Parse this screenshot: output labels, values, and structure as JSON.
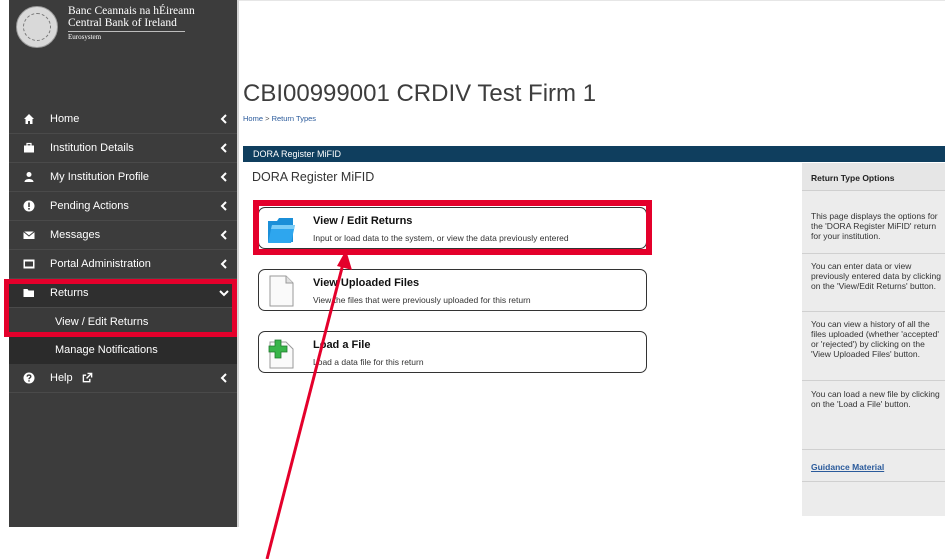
{
  "logo": {
    "line_irish": "Banc Ceannais na hÉireann",
    "line_english": "Central Bank of Ireland",
    "line_eurosystem": "Eurosystem"
  },
  "nav": {
    "items": [
      {
        "label": "Home",
        "icon": "home-icon"
      },
      {
        "label": "Institution Details",
        "icon": "briefcase-icon"
      },
      {
        "label": "My Institution Profile",
        "icon": "user-icon"
      },
      {
        "label": "Pending Actions",
        "icon": "alert-icon"
      },
      {
        "label": "Messages",
        "icon": "envelope-icon"
      },
      {
        "label": "Portal Administration",
        "icon": "panel-icon"
      },
      {
        "label": "Returns",
        "icon": "folder-icon"
      }
    ],
    "subitems": [
      {
        "label": "View / Edit Returns"
      },
      {
        "label": "Manage Notifications"
      }
    ],
    "help": {
      "label": "Help",
      "icon": "question-icon"
    }
  },
  "page": {
    "title": "CBI00999001 CRDIV Test Firm 1",
    "breadcrumb": {
      "home": "Home",
      "separator": " > ",
      "current": "Return Types"
    }
  },
  "panel": {
    "bar_title": "DORA Register MiFID",
    "heading": "DORA Register MiFID"
  },
  "options": [
    {
      "title": "View / Edit Returns",
      "desc": "Input or load data to the system, or view the data previously entered",
      "icon": "folder-icon"
    },
    {
      "title": "View Uploaded Files",
      "desc": "View the files that were previously uploaded for this return",
      "icon": "document-icon"
    },
    {
      "title": "Load a File",
      "desc": "Load a data file for this return",
      "icon": "add-document-icon"
    }
  ],
  "right_panel": {
    "title": "Return Type Options",
    "p1": "This page displays the options for the 'DORA Register MiFID' return for your institution.",
    "p2": "You can enter data or view previously entered data by clicking on the 'View/Edit Returns' button.",
    "p3": "You can view a history of all the files uploaded (whether 'accepted' or 'rejected') by clicking on the 'View Uploaded Files' button.",
    "p4": "You can load a new file by clicking on the 'Load a File' button.",
    "link": "Guidance Material"
  },
  "colors": {
    "sidebar_bg": "#3c3c3c",
    "panel_bar": "#0f3e5e",
    "highlight": "#e4002b",
    "link": "#2a5a9b"
  }
}
